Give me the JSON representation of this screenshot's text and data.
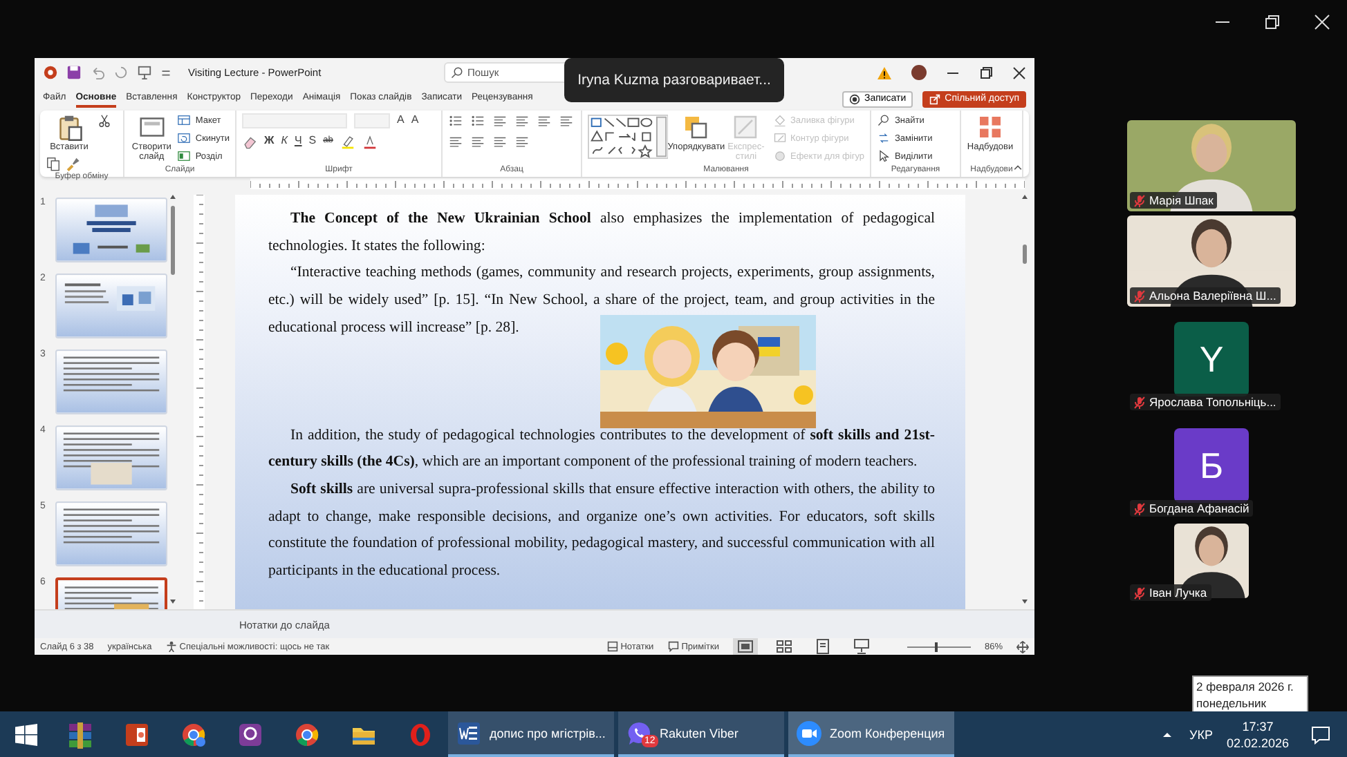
{
  "meeting": {
    "speaker_toast": "Iryna Kuzma разговаривает...",
    "participants": [
      {
        "name": "Марія Шпак",
        "kind": "video",
        "muted": true
      },
      {
        "name": "Альона Валеріївна Ш...",
        "kind": "video",
        "muted": true
      },
      {
        "name": "Ярослава Топольніць...",
        "kind": "avatar",
        "initial": "Y",
        "color": "#0b5e48",
        "muted": true
      },
      {
        "name": "Богдана Афанасій",
        "kind": "avatar",
        "initial": "Б",
        "color": "#6a3bc8",
        "muted": true
      },
      {
        "name": "Іван Лучка",
        "kind": "video",
        "muted": true
      }
    ]
  },
  "powerpoint": {
    "title": "Visiting Lecture - PowerPoint",
    "search": {
      "placeholder": "Пошук"
    },
    "tabs": [
      {
        "label": "Файл",
        "selected": false
      },
      {
        "label": "Основне",
        "selected": true
      },
      {
        "label": "Вставлення",
        "selected": false
      },
      {
        "label": "Конструктор",
        "selected": false
      },
      {
        "label": "Переходи",
        "selected": false
      },
      {
        "label": "Анімація",
        "selected": false
      },
      {
        "label": "Показ слайдів",
        "selected": false
      },
      {
        "label": "Записати",
        "selected": false
      },
      {
        "label": "Рецензування",
        "selected": false
      }
    ],
    "record_button": "Записати",
    "share_button": "Спільний доступ",
    "ribbon_groups": [
      {
        "label": "Буфер обміну",
        "items": [
          {
            "kind": "large",
            "label": "Вставити",
            "disabled": false
          },
          {
            "kind": "icon",
            "disabled": false
          },
          {
            "kind": "icon",
            "disabled": false
          },
          {
            "kind": "icon",
            "disabled": false
          }
        ]
      },
      {
        "label": "Слайди",
        "items": [
          {
            "kind": "large",
            "label": "Створити слайд",
            "disabled": false
          },
          {
            "kind": "small",
            "label": "Макет",
            "disabled": false
          },
          {
            "kind": "small",
            "label": "Скинути",
            "disabled": false
          },
          {
            "kind": "small",
            "label": "Розділ",
            "disabled": false
          }
        ]
      },
      {
        "label": "Шрифт",
        "items": [
          {
            "kind": "field",
            "disabled": true
          },
          {
            "kind": "field",
            "disabled": true
          },
          {
            "kind": "glyph",
            "label": "A",
            "disabled": false
          },
          {
            "kind": "glyph",
            "label": "A",
            "disabled": false
          },
          {
            "kind": "icon",
            "disabled": false
          },
          {
            "kind": "glyph",
            "label": "Ж",
            "disabled": false
          },
          {
            "kind": "glyph",
            "label": "К",
            "disabled": false
          },
          {
            "kind": "glyph",
            "label": "Ч",
            "disabled": false
          },
          {
            "kind": "glyph",
            "label": "S",
            "disabled": false
          },
          {
            "kind": "glyph",
            "label": "ab",
            "disabled": false
          },
          {
            "kind": "icon",
            "disabled": false
          },
          {
            "kind": "icon",
            "disabled": false
          }
        ]
      },
      {
        "label": "Абзац",
        "items": [
          {
            "kind": "icon",
            "disabled": false
          },
          {
            "kind": "icon",
            "disabled": false
          },
          {
            "kind": "icon",
            "disabled": false
          },
          {
            "kind": "icon",
            "disabled": false
          },
          {
            "kind": "icon",
            "disabled": false
          },
          {
            "kind": "icon",
            "disabled": false
          },
          {
            "kind": "icon",
            "disabled": false
          },
          {
            "kind": "icon",
            "disabled": false
          },
          {
            "kind": "icon",
            "disabled": false
          },
          {
            "kind": "icon",
            "disabled": false
          }
        ]
      },
      {
        "label": "Малювання",
        "items": [
          {
            "kind": "shapes",
            "disabled": false
          },
          {
            "kind": "large",
            "label": "Упорядкувати",
            "disabled": false
          },
          {
            "kind": "large",
            "label": "Експрес-стилі",
            "disabled": true
          },
          {
            "kind": "small",
            "label": "Заливка фігури",
            "disabled": true
          },
          {
            "kind": "small",
            "label": "Контур фігури",
            "disabled": true
          },
          {
            "kind": "small",
            "label": "Ефекти для фігур",
            "disabled": true
          }
        ]
      },
      {
        "label": "Редагування",
        "items": [
          {
            "kind": "small",
            "label": "Знайти",
            "disabled": false
          },
          {
            "kind": "small",
            "label": "Замінити",
            "disabled": false
          },
          {
            "kind": "small",
            "label": "Виділити",
            "disabled": false
          }
        ]
      },
      {
        "label": "Надбудови",
        "items": [
          {
            "kind": "large",
            "label": "Надбудови",
            "disabled": false
          }
        ]
      }
    ],
    "thumbnails": [
      {
        "number": "1",
        "selected": false
      },
      {
        "number": "2",
        "selected": false
      },
      {
        "number": "3",
        "selected": false
      },
      {
        "number": "4",
        "selected": false
      },
      {
        "number": "5",
        "selected": false
      },
      {
        "number": "6",
        "selected": true
      }
    ],
    "slide": {
      "paragraphs": [
        {
          "text": "**The Concept of the New Ukrainian School** also emphasizes the implementation of pedagogical technologies. It states the following:"
        },
        {
          "text": "“Interactive teaching methods (games, community and research projects, experiments, group assignments, etc.) will be widely used” [p. 15]. “In New School, a share of the project, team, and group activities in the educational process will increase” [p. 28]."
        },
        {
          "kind": "picture"
        },
        {
          "text": "In addition, the study of pedagogical technologies contributes to the development of **soft skills and 21st-century skills (the 4Cs)**, which are an important component of the professional training of modern teachers."
        },
        {
          "text": "**Soft skills** are universal supra-professional skills that ensure effective interaction with others, the ability to adapt to change, make responsible decisions, and organize one’s own activities. For educators, soft skills constitute the foundation of professional mobility, pedagogical mastery, and successful communication with all participants in the educational process."
        }
      ]
    },
    "notes_placeholder": "Нотатки до слайда",
    "status_bar": {
      "slide_counter": "Слайд 6 з 38",
      "language": "українська",
      "accessibility": "Спеціальні можливості: щось не так",
      "notes_button": "Нотатки",
      "comments_button": "Примітки",
      "views": [
        {
          "selected": true
        },
        {
          "selected": false
        },
        {
          "selected": false
        },
        {
          "selected": false
        }
      ],
      "zoom": {
        "level": 0.45,
        "reading": "86%"
      }
    }
  },
  "taskbar": {
    "windows": [
      {
        "label": "допис про мгістрів...",
        "selected": false
      },
      {
        "label": "Rakuten Viber",
        "badge": "12",
        "selected": false
      },
      {
        "label": "Zoom Конференция",
        "selected": true
      }
    ],
    "language": "УКР",
    "time": "17:37",
    "date": "02.02.2026",
    "date_tooltip": [
      "2 февраля 2026 г.",
      "понедельник"
    ]
  }
}
